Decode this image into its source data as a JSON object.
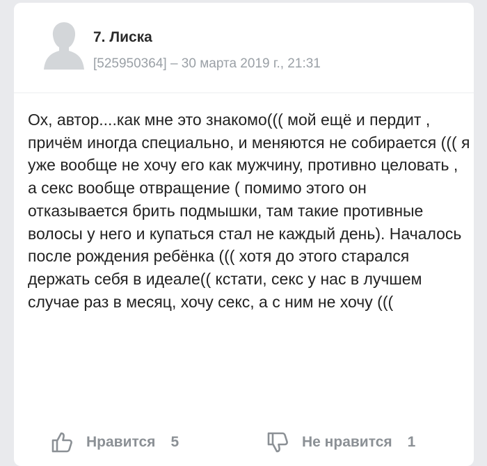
{
  "comment": {
    "author": "7. Лиска",
    "meta": "[525950364] – 30 марта 2019 г., 21:31",
    "avatar_icon": "user-silhouette-icon",
    "text": "Ох, автор....как мне это знакомо((( мой ещё и пердит , причём иногда специально, и меняются не собирается ((( я уже вообще не хочу его как мужчину, противно целовать , а секс вообще отвращение ( помимо этого он отказывается брить подмышки, там такие противные волосы у него и купаться стал не каждый день). Началось после рождения ребёнка ((( хотя до этого старался держать себя в идеале(( кстати, секс у нас в лучшем случае раз в месяц, хочу секс, а с ним не хочу (((",
    "like": {
      "label": "Нравится",
      "count": "5",
      "icon": "thumbs-up-icon"
    },
    "dislike": {
      "label": "Не нравится",
      "count": "1",
      "icon": "thumbs-down-icon"
    }
  },
  "colors": {
    "background": "#e9eaed",
    "card": "#ffffff",
    "text": "#222222",
    "muted": "#9aa0a6",
    "action": "#8b9095",
    "avatar": "#d3d6d9"
  }
}
